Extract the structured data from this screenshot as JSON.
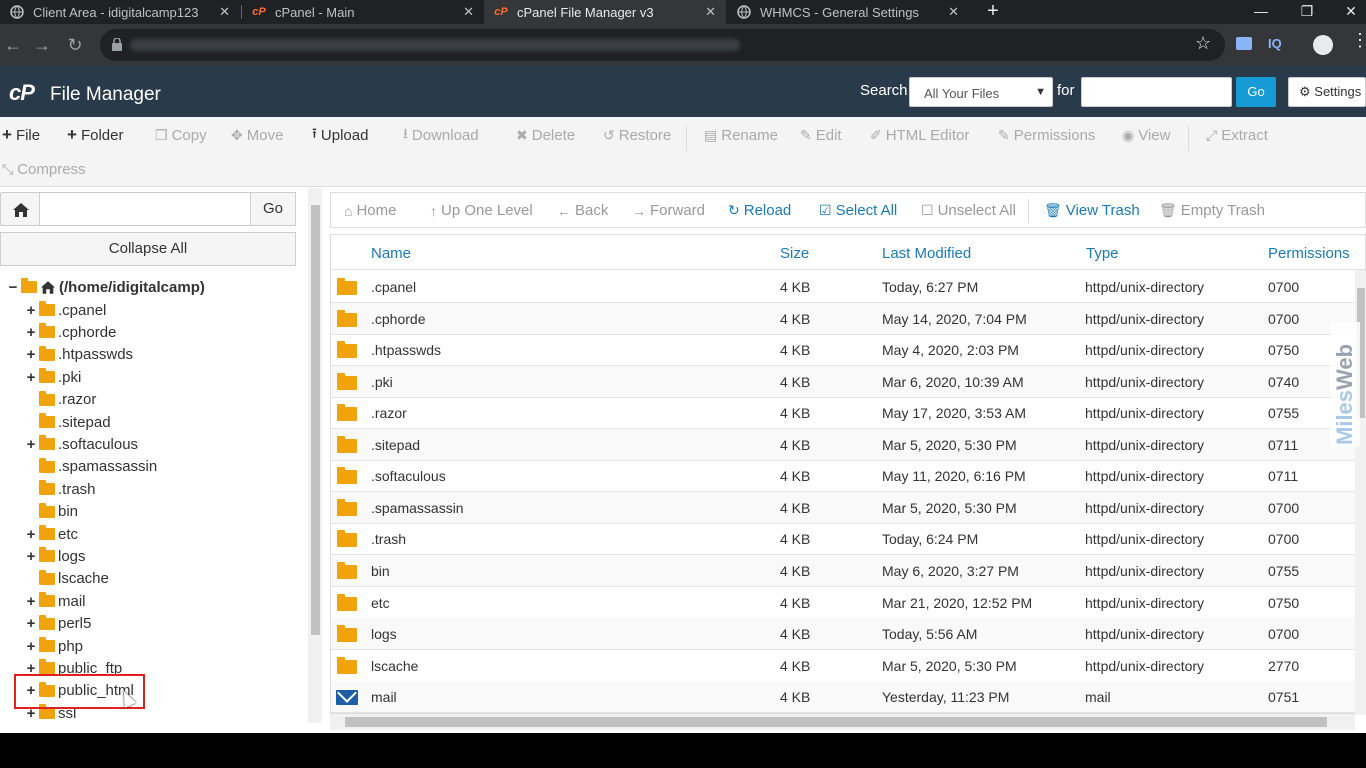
{
  "browser": {
    "tabs": [
      {
        "title": "Client Area - idigitalcamp123",
        "icon": "globe-icon",
        "active": false
      },
      {
        "title": "cPanel - Main",
        "icon": "cpanel-icon",
        "active": false
      },
      {
        "title": "cPanel File Manager v3",
        "icon": "cpanel-icon",
        "active": true
      },
      {
        "title": "WHMCS - General Settings",
        "icon": "globe-icon",
        "active": false
      }
    ],
    "new_tab": "+",
    "close_glyph": "✕",
    "window_controls": {
      "minimize": "—",
      "restore": "❐",
      "close": "✕"
    },
    "extension_label": "IQ"
  },
  "header": {
    "logo": "cP",
    "title": "File Manager",
    "search_label": "Search",
    "search_scope": "All Your Files",
    "for_label": "for",
    "search_value": "",
    "go_label": "Go",
    "settings_label": "Settings"
  },
  "toolbar": {
    "items": [
      {
        "label": "File",
        "icon": "plus-icon",
        "enabled": true
      },
      {
        "label": "Folder",
        "icon": "plus-icon",
        "enabled": true
      },
      {
        "label": "Copy",
        "icon": "copy-icon",
        "enabled": false
      },
      {
        "label": "Move",
        "icon": "move-icon",
        "enabled": false
      },
      {
        "label": "Upload",
        "icon": "upload-icon",
        "enabled": true
      },
      {
        "label": "Download",
        "icon": "download-icon",
        "enabled": false
      },
      {
        "label": "Delete",
        "icon": "delete-icon",
        "enabled": false
      },
      {
        "label": "Restore",
        "icon": "restore-icon",
        "enabled": false
      },
      {
        "label": "Rename",
        "icon": "rename-icon",
        "enabled": false
      },
      {
        "label": "Edit",
        "icon": "edit-icon",
        "enabled": false
      },
      {
        "label": "HTML Editor",
        "icon": "html-editor-icon",
        "enabled": false
      },
      {
        "label": "Permissions",
        "icon": "key-icon",
        "enabled": false
      },
      {
        "label": "View",
        "icon": "eye-icon",
        "enabled": false
      },
      {
        "label": "Extract",
        "icon": "extract-icon",
        "enabled": false
      },
      {
        "label": "Compress",
        "icon": "compress-icon",
        "enabled": false
      }
    ]
  },
  "sidebar": {
    "path_value": "",
    "go_label": "Go",
    "collapse_label": "Collapse All",
    "root_label": "(/home/idigitalcamp)",
    "tree": [
      {
        "label": ".cpanel",
        "expandable": true
      },
      {
        "label": ".cphorde",
        "expandable": true
      },
      {
        "label": ".htpasswds",
        "expandable": true
      },
      {
        "label": ".pki",
        "expandable": true
      },
      {
        "label": ".razor",
        "expandable": false
      },
      {
        "label": ".sitepad",
        "expandable": false
      },
      {
        "label": ".softaculous",
        "expandable": true
      },
      {
        "label": ".spamassassin",
        "expandable": false
      },
      {
        "label": ".trash",
        "expandable": false
      },
      {
        "label": "bin",
        "expandable": false
      },
      {
        "label": "etc",
        "expandable": true
      },
      {
        "label": "logs",
        "expandable": true
      },
      {
        "label": "lscache",
        "expandable": false
      },
      {
        "label": "mail",
        "expandable": true
      },
      {
        "label": "perl5",
        "expandable": true
      },
      {
        "label": "php",
        "expandable": true
      },
      {
        "label": "public_ftp",
        "expandable": true
      },
      {
        "label": "public_html",
        "expandable": true,
        "highlighted": true
      },
      {
        "label": "ssl",
        "expandable": true
      }
    ]
  },
  "navbar": {
    "items": [
      {
        "label": "Home",
        "icon": "home-icon",
        "enabled": false
      },
      {
        "label": "Up One Level",
        "icon": "up-arrow-icon",
        "enabled": false
      },
      {
        "label": "Back",
        "icon": "back-arrow-icon",
        "enabled": false
      },
      {
        "label": "Forward",
        "icon": "forward-arrow-icon",
        "enabled": false
      },
      {
        "label": "Reload",
        "icon": "reload-icon",
        "enabled": true
      },
      {
        "label": "Select All",
        "icon": "checkbox-checked-icon",
        "enabled": true
      },
      {
        "label": "Unselect All",
        "icon": "checkbox-empty-icon",
        "enabled": false
      },
      {
        "label": "View Trash",
        "icon": "trash-icon",
        "enabled": true
      },
      {
        "label": "Empty Trash",
        "icon": "trash-icon",
        "enabled": false
      }
    ]
  },
  "table": {
    "columns": [
      "Name",
      "Size",
      "Last Modified",
      "Type",
      "Permissions"
    ],
    "rows": [
      {
        "name": ".cpanel",
        "size": "4 KB",
        "modified": "Today, 6:27 PM",
        "type": "httpd/unix-directory",
        "perms": "0700",
        "icon": "folder-icon"
      },
      {
        "name": ".cphorde",
        "size": "4 KB",
        "modified": "May 14, 2020, 7:04 PM",
        "type": "httpd/unix-directory",
        "perms": "0700",
        "icon": "folder-icon"
      },
      {
        "name": ".htpasswds",
        "size": "4 KB",
        "modified": "May 4, 2020, 2:03 PM",
        "type": "httpd/unix-directory",
        "perms": "0750",
        "icon": "folder-icon"
      },
      {
        "name": ".pki",
        "size": "4 KB",
        "modified": "Mar 6, 2020, 10:39 AM",
        "type": "httpd/unix-directory",
        "perms": "0740",
        "icon": "folder-icon"
      },
      {
        "name": ".razor",
        "size": "4 KB",
        "modified": "May 17, 2020, 3:53 AM",
        "type": "httpd/unix-directory",
        "perms": "0755",
        "icon": "folder-icon"
      },
      {
        "name": ".sitepad",
        "size": "4 KB",
        "modified": "Mar 5, 2020, 5:30 PM",
        "type": "httpd/unix-directory",
        "perms": "0711",
        "icon": "folder-icon"
      },
      {
        "name": ".softaculous",
        "size": "4 KB",
        "modified": "May 11, 2020, 6:16 PM",
        "type": "httpd/unix-directory",
        "perms": "0711",
        "icon": "folder-icon"
      },
      {
        "name": ".spamassassin",
        "size": "4 KB",
        "modified": "Mar 5, 2020, 5:30 PM",
        "type": "httpd/unix-directory",
        "perms": "0700",
        "icon": "folder-icon"
      },
      {
        "name": ".trash",
        "size": "4 KB",
        "modified": "Today, 6:24 PM",
        "type": "httpd/unix-directory",
        "perms": "0700",
        "icon": "folder-icon"
      },
      {
        "name": "bin",
        "size": "4 KB",
        "modified": "May 6, 2020, 3:27 PM",
        "type": "httpd/unix-directory",
        "perms": "0755",
        "icon": "folder-icon"
      },
      {
        "name": "etc",
        "size": "4 KB",
        "modified": "Mar 21, 2020, 12:52 PM",
        "type": "httpd/unix-directory",
        "perms": "0750",
        "icon": "folder-icon"
      },
      {
        "name": "logs",
        "size": "4 KB",
        "modified": "Today, 5:56 AM",
        "type": "httpd/unix-directory",
        "perms": "0700",
        "icon": "folder-icon"
      },
      {
        "name": "lscache",
        "size": "4 KB",
        "modified": "Mar 5, 2020, 5:30 PM",
        "type": "httpd/unix-directory",
        "perms": "2770",
        "icon": "folder-icon"
      },
      {
        "name": "mail",
        "size": "4 KB",
        "modified": "Yesterday, 11:23 PM",
        "type": "mail",
        "perms": "0751",
        "icon": "mail-icon"
      }
    ]
  },
  "watermark": {
    "part1": "Miles",
    "part2": "Web"
  },
  "colors": {
    "header_bg": "#293a4a",
    "accent": "#179bd7",
    "link": "#1a7bb9",
    "folder": "#f0a30a",
    "highlight": "#e0201f"
  }
}
